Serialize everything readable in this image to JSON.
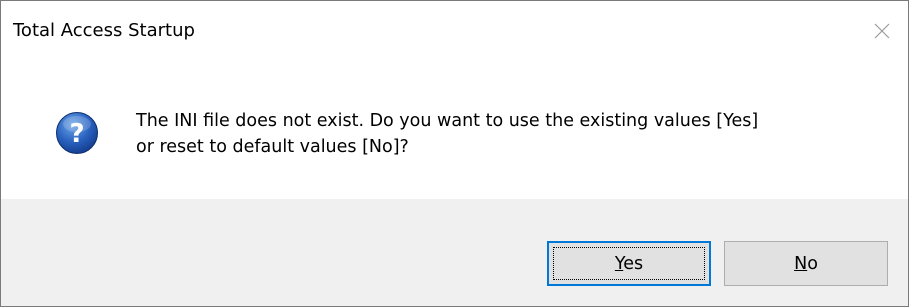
{
  "window": {
    "title": "Total Access Startup",
    "close_icon": "close-icon"
  },
  "message": {
    "icon": "question-icon",
    "line1": "The INI file does not exist. Do you want to use the existing values [Yes]",
    "line2": "or reset to default values [No]?"
  },
  "buttons": {
    "yes": {
      "accel": "Y",
      "rest": "es"
    },
    "no": {
      "accel": "N",
      "rest": "o"
    }
  },
  "colors": {
    "accent": "#0078d7",
    "footer_bg": "#f0f0f0",
    "button_bg": "#e1e1e1"
  }
}
